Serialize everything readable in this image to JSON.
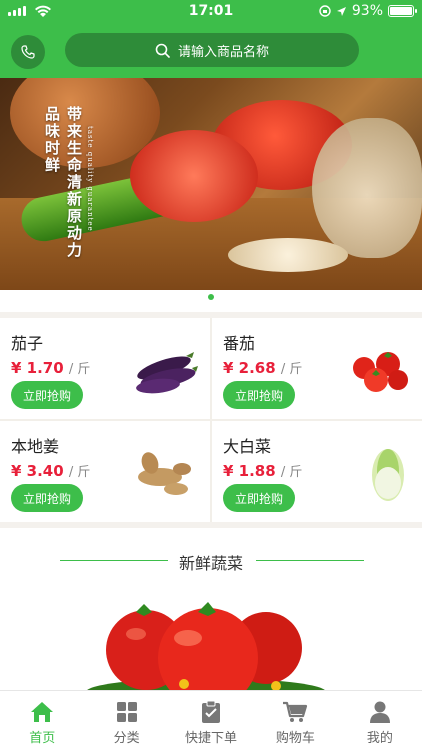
{
  "status_bar": {
    "time": "17:01",
    "battery": "93%",
    "battery_level": 0.93
  },
  "header": {
    "search_placeholder": "请输入商品名称",
    "phone_icon": "phone-icon",
    "search_icon": "search-icon"
  },
  "banner": {
    "line1": "品味时鲜",
    "line2": "带来生命清新原动力",
    "line3": "taste quality guarantee",
    "active_index": 0,
    "count": 1
  },
  "products": [
    {
      "name": "茄子",
      "currency": "¥",
      "price": "1.70",
      "unit": "/ 斤",
      "buy_label": "立即抢购",
      "image": "eggplant"
    },
    {
      "name": "番茄",
      "currency": "¥",
      "price": "2.68",
      "unit": "/ 斤",
      "buy_label": "立即抢购",
      "image": "tomato"
    },
    {
      "name": "本地姜",
      "currency": "¥",
      "price": "3.40",
      "unit": "/ 斤",
      "buy_label": "立即抢购",
      "image": "ginger"
    },
    {
      "name": "大白菜",
      "currency": "¥",
      "price": "1.88",
      "unit": "/ 斤",
      "buy_label": "立即抢购",
      "image": "cabbage"
    }
  ],
  "section": {
    "title": "新鲜蔬菜"
  },
  "tabbar": [
    {
      "label": "首页",
      "icon": "home-icon",
      "active": true
    },
    {
      "label": "分类",
      "icon": "grid-icon",
      "active": false
    },
    {
      "label": "快捷下单",
      "icon": "clipboard-icon",
      "active": false
    },
    {
      "label": "购物车",
      "icon": "cart-icon",
      "active": false
    },
    {
      "label": "我的",
      "icon": "user-icon",
      "active": false
    }
  ],
  "colors": {
    "brand": "#3dbe4a",
    "brand_dark": "#2e8c39",
    "price": "#e8203a"
  }
}
